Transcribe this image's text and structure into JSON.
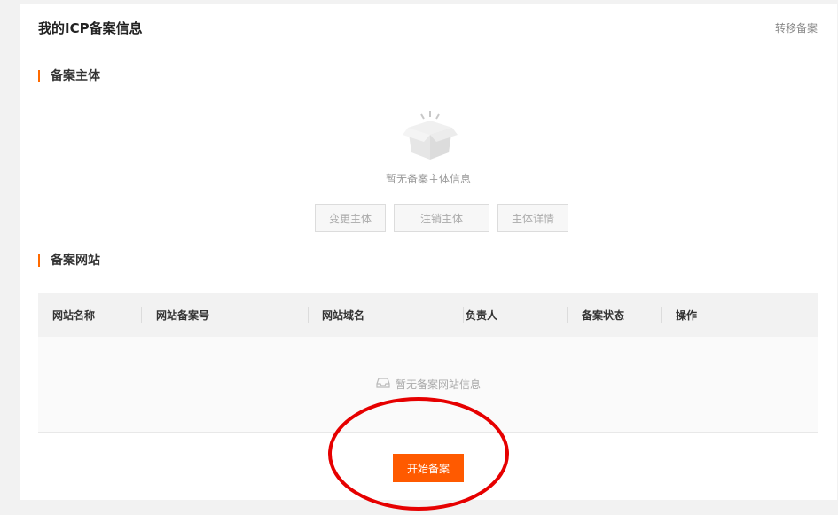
{
  "header": {
    "title": "我的ICP备案信息",
    "transfer_link": "转移备案"
  },
  "entity_section": {
    "title": "备案主体",
    "empty_text": "暂无备案主体信息",
    "buttons": [
      "变更主体",
      "注销主体",
      "主体详情"
    ]
  },
  "website_section": {
    "title": "备案网站",
    "columns": [
      "网站名称",
      "网站备案号",
      "网站域名",
      "负责人",
      "备案状态",
      "操作"
    ],
    "empty_text": "暂无备案网站信息",
    "start_button": "开始备案"
  },
  "colors": {
    "accent": "#ff6a00",
    "primary_button": "#ff5a00",
    "annotation": "#e60000"
  },
  "icons": {
    "entity_empty": "open-box-icon",
    "website_empty": "empty-tray-icon"
  }
}
